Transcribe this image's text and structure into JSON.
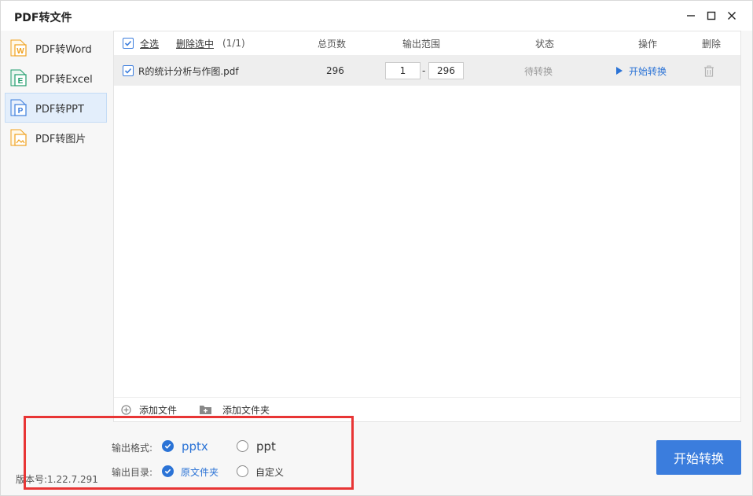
{
  "window": {
    "title": "PDF转文件"
  },
  "sidebar": {
    "items": [
      {
        "label": "PDF转Word",
        "letter": "W",
        "color": "#f0a11e"
      },
      {
        "label": "PDF转Excel",
        "letter": "E",
        "color": "#1e9b6b"
      },
      {
        "label": "PDF转PPT",
        "letter": "P",
        "color": "#3b7ddd"
      },
      {
        "label": "PDF转图片",
        "letter": "",
        "color": "#f0a11e"
      }
    ],
    "active_index": 2
  },
  "table": {
    "select_all": "全选",
    "delete_selected": "删除选中",
    "count": "(1/1)",
    "headers": {
      "pages": "总页数",
      "range": "输出范围",
      "status": "状态",
      "action": "操作",
      "delete": "删除"
    },
    "rows": [
      {
        "name": "R的统计分析与作图.pdf",
        "pages": "296",
        "range_from": "1",
        "range_sep": "-",
        "range_to": "296",
        "status": "待转换",
        "action": "开始转换"
      }
    ]
  },
  "footer": {
    "add_file": "添加文件",
    "add_folder": "添加文件夹"
  },
  "options": {
    "format_label": "输出格式:",
    "format_pptx": "pptx",
    "format_ppt": "ppt",
    "dir_label": "输出目录:",
    "dir_original": "原文件夹",
    "dir_custom": "自定义"
  },
  "version": "版本号:1.22.7.291",
  "start_button": "开始转换",
  "colors": {
    "accent": "#3b7ddd",
    "highlight": "#e83535"
  }
}
